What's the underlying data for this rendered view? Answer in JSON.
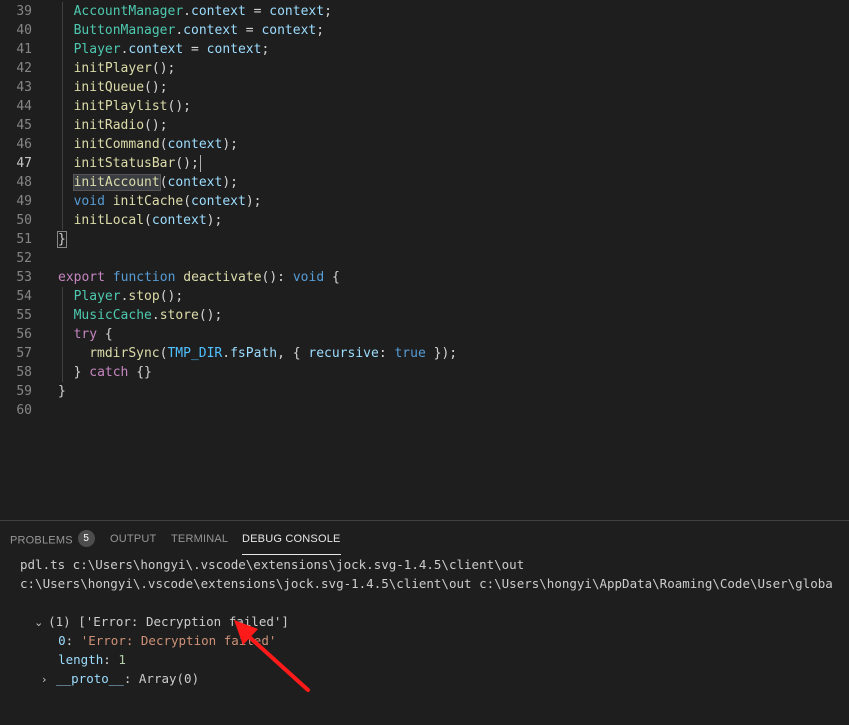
{
  "editor": {
    "lines": [
      {
        "n": "39",
        "tokens": [
          [
            "var",
            "AccountManager"
          ],
          [
            "plain",
            "."
          ],
          [
            "prop",
            "context"
          ],
          [
            "plain",
            " = "
          ],
          [
            "prop",
            "context"
          ],
          [
            "plain",
            ";"
          ]
        ]
      },
      {
        "n": "40",
        "tokens": [
          [
            "var",
            "ButtonManager"
          ],
          [
            "plain",
            "."
          ],
          [
            "prop",
            "context"
          ],
          [
            "plain",
            " = "
          ],
          [
            "prop",
            "context"
          ],
          [
            "plain",
            ";"
          ]
        ]
      },
      {
        "n": "41",
        "tokens": [
          [
            "var",
            "Player"
          ],
          [
            "plain",
            "."
          ],
          [
            "prop",
            "context"
          ],
          [
            "plain",
            " = "
          ],
          [
            "prop",
            "context"
          ],
          [
            "plain",
            ";"
          ]
        ]
      },
      {
        "n": "42",
        "tokens": [
          [
            "fn",
            "initPlayer"
          ],
          [
            "plain",
            "();"
          ]
        ]
      },
      {
        "n": "43",
        "tokens": [
          [
            "fn",
            "initQueue"
          ],
          [
            "plain",
            "();"
          ]
        ]
      },
      {
        "n": "44",
        "tokens": [
          [
            "fn",
            "initPlaylist"
          ],
          [
            "plain",
            "();"
          ]
        ]
      },
      {
        "n": "45",
        "tokens": [
          [
            "fn",
            "initRadio"
          ],
          [
            "plain",
            "();"
          ]
        ]
      },
      {
        "n": "46",
        "tokens": [
          [
            "fn",
            "initCommand"
          ],
          [
            "plain",
            "("
          ],
          [
            "prop",
            "context"
          ],
          [
            "plain",
            ");"
          ]
        ]
      },
      {
        "n": "47",
        "tokens": [
          [
            "fn",
            "initStatusBar"
          ],
          [
            "plain",
            "();"
          ]
        ],
        "active": true
      },
      {
        "n": "48",
        "tokens": [
          [
            "fnhl",
            "initAccount"
          ],
          [
            "plain",
            "("
          ],
          [
            "prop",
            "context"
          ],
          [
            "plain",
            ");"
          ]
        ]
      },
      {
        "n": "49",
        "tokens": [
          [
            "kw",
            "void"
          ],
          [
            "plain",
            " "
          ],
          [
            "fn",
            "initCache"
          ],
          [
            "plain",
            "("
          ],
          [
            "prop",
            "context"
          ],
          [
            "plain",
            ");"
          ]
        ]
      },
      {
        "n": "50",
        "tokens": [
          [
            "fn",
            "initLocal"
          ],
          [
            "plain",
            "("
          ],
          [
            "prop",
            "context"
          ],
          [
            "plain",
            ");"
          ]
        ]
      },
      {
        "n": "51",
        "tokens": [
          [
            "bracket",
            "}"
          ]
        ],
        "indent": 0
      },
      {
        "n": "52",
        "tokens": []
      },
      {
        "n": "53",
        "tokens": [
          [
            "ctrl",
            "export"
          ],
          [
            "plain",
            " "
          ],
          [
            "kw",
            "function"
          ],
          [
            "plain",
            " "
          ],
          [
            "fn",
            "deactivate"
          ],
          [
            "plain",
            "(): "
          ],
          [
            "kw",
            "void"
          ],
          [
            "plain",
            " {"
          ]
        ],
        "indent": 0
      },
      {
        "n": "54",
        "tokens": [
          [
            "var",
            "Player"
          ],
          [
            "plain",
            "."
          ],
          [
            "fn",
            "stop"
          ],
          [
            "plain",
            "();"
          ]
        ]
      },
      {
        "n": "55",
        "tokens": [
          [
            "var",
            "MusicCache"
          ],
          [
            "plain",
            "."
          ],
          [
            "fn",
            "store"
          ],
          [
            "plain",
            "();"
          ]
        ]
      },
      {
        "n": "56",
        "tokens": [
          [
            "ctrl",
            "try"
          ],
          [
            "plain",
            " {"
          ]
        ]
      },
      {
        "n": "57",
        "tokens": [
          [
            "fn",
            "rmdirSync"
          ],
          [
            "plain",
            "("
          ],
          [
            "const",
            "TMP_DIR"
          ],
          [
            "plain",
            "."
          ],
          [
            "prop",
            "fsPath"
          ],
          [
            "plain",
            ", { "
          ],
          [
            "prop",
            "recursive"
          ],
          [
            "plain",
            ": "
          ],
          [
            "kw",
            "true"
          ],
          [
            "plain",
            " });"
          ]
        ],
        "indent": 2
      },
      {
        "n": "58",
        "tokens": [
          [
            "plain",
            "} "
          ],
          [
            "ctrl",
            "catch"
          ],
          [
            "plain",
            " {}"
          ]
        ]
      },
      {
        "n": "59",
        "tokens": [
          [
            "plain",
            "}"
          ]
        ],
        "indent": 0
      },
      {
        "n": "60",
        "tokens": []
      }
    ]
  },
  "panel": {
    "tabs": [
      {
        "label": "PROBLEMS",
        "badge": "5",
        "active": false
      },
      {
        "label": "OUTPUT",
        "active": false
      },
      {
        "label": "TERMINAL",
        "active": false
      },
      {
        "label": "DEBUG CONSOLE",
        "active": true
      }
    ],
    "console": {
      "line1": "pdl.ts c:\\Users\\hongyi\\.vscode\\extensions\\jock.svg-1.4.5\\client\\out",
      "line2": "c:\\Users\\hongyi\\.vscode\\extensions\\jock.svg-1.4.5\\client\\out c:\\Users\\hongyi\\AppData\\Roaming\\Code\\User\\globa",
      "array_summary": "(1) ['Error: Decryption failed']",
      "item_key": "0",
      "item_value": "'Error: Decryption failed'",
      "length_key": "length",
      "length_value": "1",
      "proto_key": "__proto__",
      "proto_value": "Array(0)"
    }
  },
  "colors": {
    "background": "#1e1e1e",
    "annotation_arrow": "#ff1a1a"
  }
}
